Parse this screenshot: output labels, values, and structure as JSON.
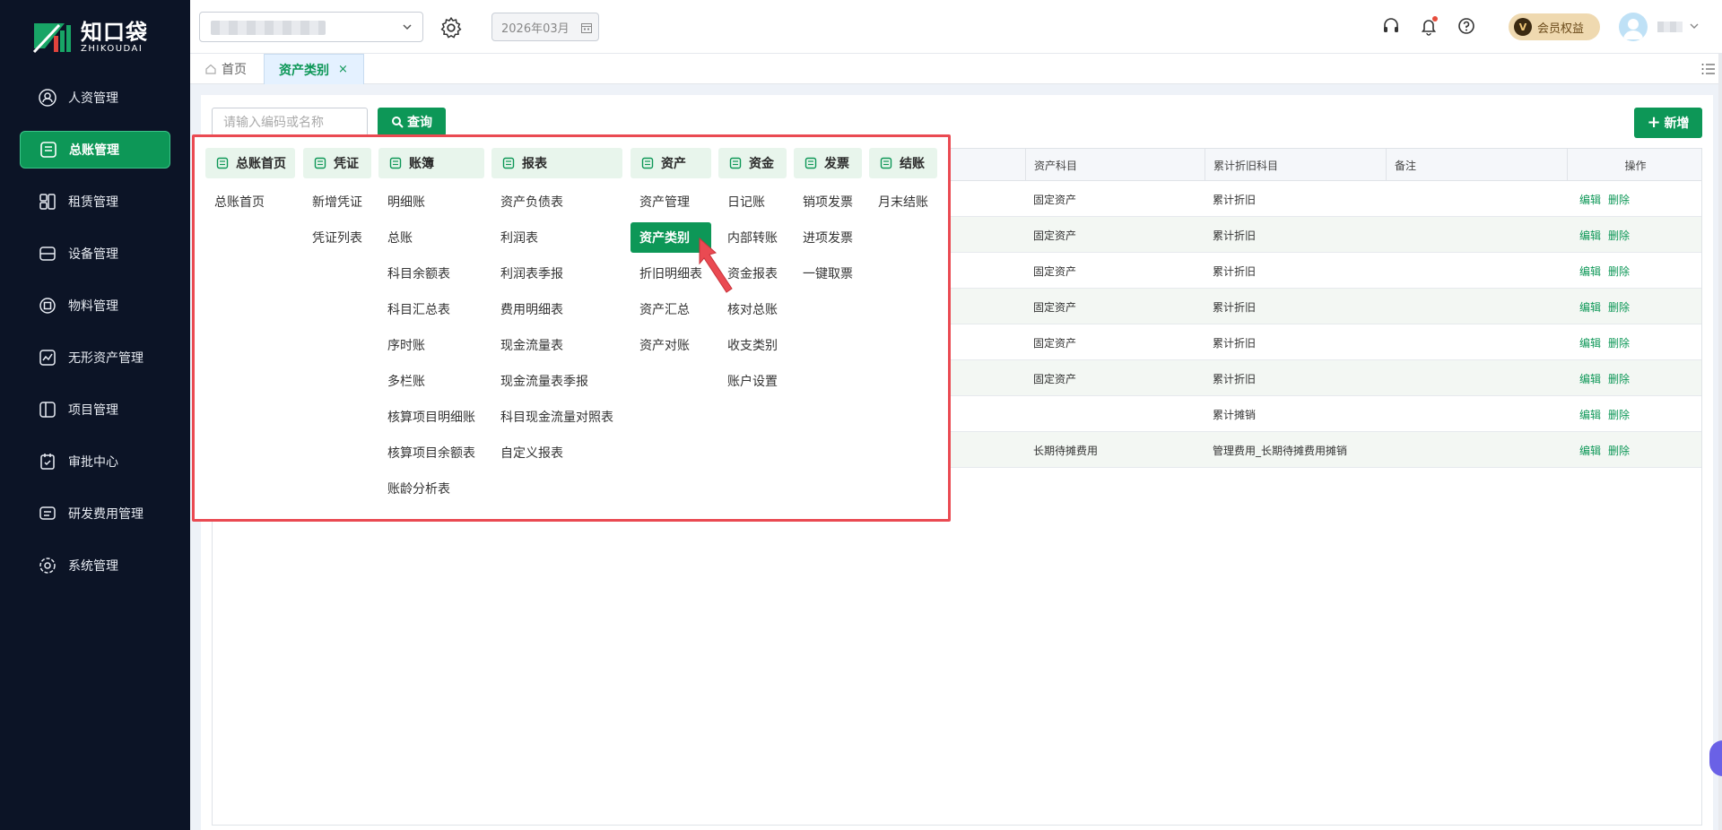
{
  "brand": {
    "name_cn": "知口袋",
    "name_en": "ZHIKOUDAI",
    "colors": {
      "primary": "#0d9757",
      "sidebar": "#0c1426",
      "highlight": "#ea4a52"
    }
  },
  "sidebar": {
    "items": [
      {
        "label": "人资管理",
        "icon": "user-shield-icon"
      },
      {
        "label": "总账管理",
        "icon": "ledger-icon",
        "active": true
      },
      {
        "label": "租赁管理",
        "icon": "lease-icon"
      },
      {
        "label": "设备管理",
        "icon": "device-icon"
      },
      {
        "label": "物料管理",
        "icon": "material-icon"
      },
      {
        "label": "无形资产管理",
        "icon": "intangible-icon"
      },
      {
        "label": "项目管理",
        "icon": "project-icon"
      },
      {
        "label": "审批中心",
        "icon": "approval-icon"
      },
      {
        "label": "研发费用管理",
        "icon": "rd-icon"
      },
      {
        "label": "系统管理",
        "icon": "settings-icon"
      }
    ]
  },
  "topbar": {
    "period": "2026年03月",
    "member_label": "会员权益",
    "member_badge": "V"
  },
  "tabs": {
    "home": "首页",
    "active": "资产类别",
    "close": "×"
  },
  "toolbar": {
    "search_placeholder": "请输入编码或名称",
    "search_label": "查询",
    "add_label": "新增"
  },
  "table": {
    "columns": [
      "资产科目",
      "累计折旧科目",
      "备注",
      "操作"
    ],
    "rows": [
      {
        "asset_account": "固定资产",
        "depr_account": "累计折旧",
        "note": ""
      },
      {
        "asset_account": "固定资产",
        "depr_account": "累计折旧",
        "note": ""
      },
      {
        "asset_account": "固定资产",
        "depr_account": "累计折旧",
        "note": ""
      },
      {
        "asset_account": "固定资产",
        "depr_account": "累计折旧",
        "note": ""
      },
      {
        "asset_account": "固定资产",
        "depr_account": "累计折旧",
        "note": ""
      },
      {
        "asset_account": "固定资产",
        "depr_account": "累计折旧",
        "note": ""
      },
      {
        "asset_account": "",
        "depr_account": "累计摊销",
        "note": ""
      },
      {
        "asset_account": "长期待摊费用",
        "depr_account": "管理费用_长期待摊费用摊销",
        "note": ""
      }
    ],
    "edit_label": "编辑",
    "delete_label": "删除"
  },
  "mega_menu": {
    "columns": [
      {
        "title": "总账首页",
        "icon": "ledger-home-icon",
        "items": [
          "总账首页"
        ]
      },
      {
        "title": "凭证",
        "icon": "voucher-icon",
        "items": [
          "新增凭证",
          "凭证列表"
        ]
      },
      {
        "title": "账簿",
        "icon": "book-icon",
        "items": [
          "明细账",
          "总账",
          "科目余额表",
          "科目汇总表",
          "序时账",
          "多栏账",
          "核算项目明细账",
          "核算项目余额表",
          "账龄分析表"
        ]
      },
      {
        "title": "报表",
        "icon": "report-icon",
        "items": [
          "资产负债表",
          "利润表",
          "利润表季报",
          "费用明细表",
          "现金流量表",
          "现金流量表季报",
          "科目现金流量对照表",
          "自定义报表"
        ]
      },
      {
        "title": "资产",
        "icon": "asset-icon",
        "items": [
          "资产管理",
          "资产类别",
          "折旧明细表",
          "资产汇总",
          "资产对账"
        ],
        "active_item": "资产类别"
      },
      {
        "title": "资金",
        "icon": "fund-icon",
        "items": [
          "日记账",
          "内部转账",
          "资金报表",
          "核对总账",
          "收支类别",
          "账户设置"
        ]
      },
      {
        "title": "发票",
        "icon": "invoice-icon",
        "items": [
          "销项发票",
          "进项发票",
          "一键取票"
        ]
      },
      {
        "title": "结账",
        "icon": "close-period-icon",
        "items": [
          "月末结账"
        ]
      }
    ]
  }
}
